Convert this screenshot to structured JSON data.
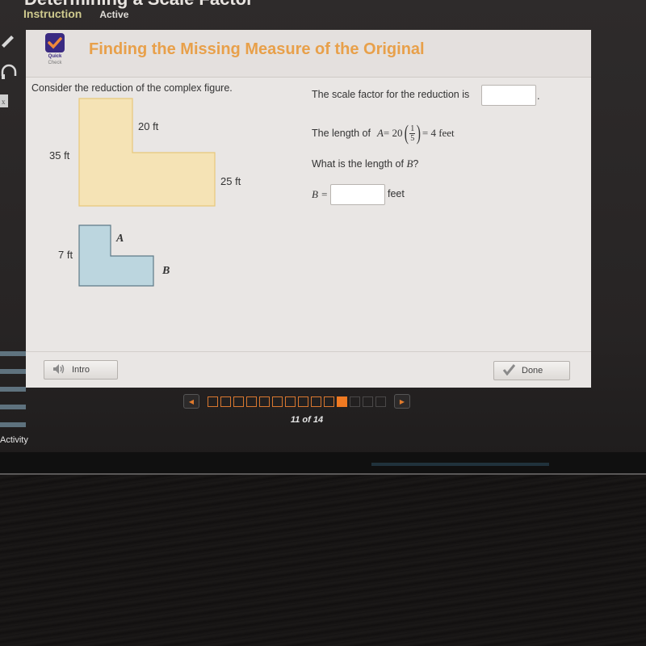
{
  "app": {
    "title": "Determining a Scale Factor",
    "tabs": [
      {
        "label": "Instruction",
        "state": "selected"
      },
      {
        "label": "Active",
        "state": "normal"
      }
    ]
  },
  "sidebar": {
    "icons": [
      "pencil-icon",
      "headphones-icon",
      "formula-icon"
    ],
    "activity_label": "Activity"
  },
  "panel": {
    "badge": {
      "line1": "Quick",
      "line2": "Check",
      "icon": "checkmark-icon",
      "color": "#3a2a82"
    },
    "title": "Finding the Missing Measure of the Original",
    "title_color": "#e8a04a",
    "prompt": "Consider the reduction of the complex figure.",
    "original_figure": {
      "fill": "#f5e3b5",
      "labels": {
        "top_step": "20 ft",
        "left_height": "35 ft",
        "right_height": "25 ft"
      }
    },
    "reduced_figure": {
      "fill": "#bcd6df",
      "labels": {
        "left_height": "7 ft",
        "segment_a": "A",
        "segment_b": "B"
      }
    },
    "questions": {
      "scale_factor_text": "The scale factor for the reduction is",
      "scale_factor_value": "",
      "scale_factor_suffix": ".",
      "length_a_prefix": "The length of",
      "length_a_var": "A",
      "length_a_eq": "= 20",
      "length_a_frac_num": "1",
      "length_a_frac_den": "5",
      "length_a_result": "= 4 feet",
      "length_b_question_prefix": "What is the length of",
      "length_b_question_var": "B",
      "length_b_question_suffix": "?",
      "b_label": "B =",
      "b_value": "",
      "b_unit": "feet"
    },
    "buttons": {
      "intro": "Intro",
      "done": "Done"
    }
  },
  "pager": {
    "current": 11,
    "total": 14,
    "label": "11 of 14",
    "accent": "#f07a22"
  }
}
